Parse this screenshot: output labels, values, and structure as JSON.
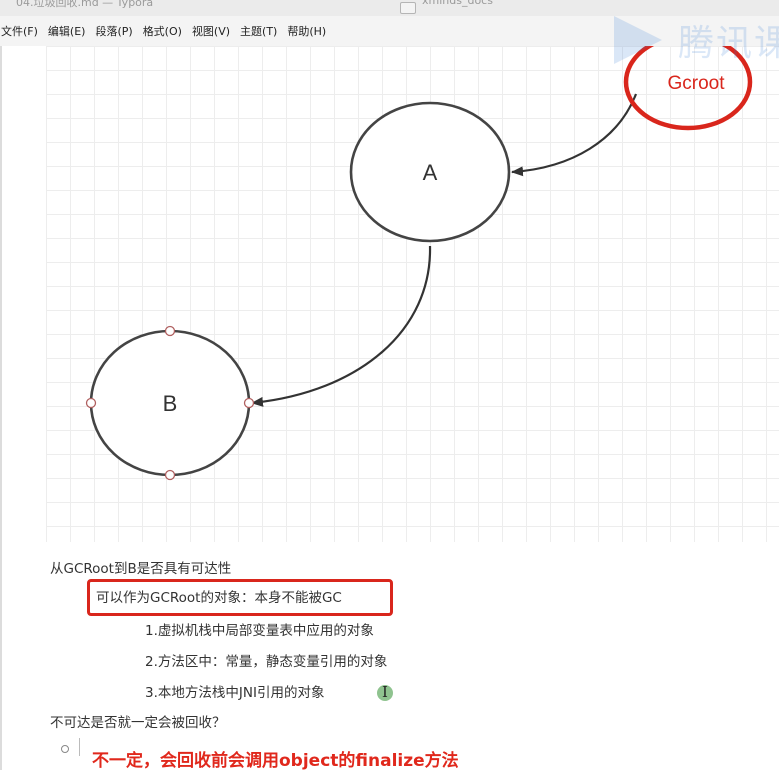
{
  "window": {
    "document_title": "04.垃圾回收.md — Typora",
    "folder_title": "xminds_docs"
  },
  "menu": {
    "items": [
      "文件(F)",
      "编辑(E)",
      "段落(P)",
      "格式(O)",
      "视图(V)",
      "主题(T)",
      "帮助(H)"
    ]
  },
  "diagram": {
    "nodes": {
      "gcroot": "Gcroot",
      "a": "A",
      "b": "B"
    },
    "colors": {
      "annotation": "#d9261c",
      "outline": "#444444",
      "handle": "#c06060"
    }
  },
  "watermark": {
    "text": "腾讯课"
  },
  "notes": {
    "question1": "从GCRoot到B是否具有可达性",
    "gcroot_heading": "可以作为GCRoot的对象：本身不能被GC",
    "item1": "1.虚拟机栈中局部变量表中应用的对象",
    "item2": "2.方法区中：常量，静态变量引用的对象",
    "item3": "3.本地方法栈中JNI引用的对象",
    "question2": "不可达是否就一定会被回收？",
    "answer": "不一定，会回收前会调用object的finalize方法"
  }
}
